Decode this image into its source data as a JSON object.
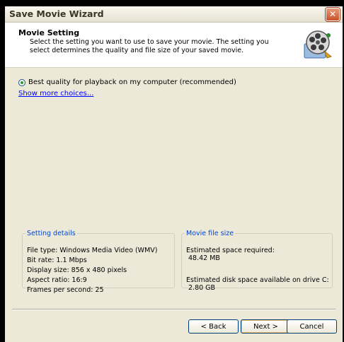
{
  "window": {
    "title": "Save Movie Wizard",
    "close_glyph": "✕"
  },
  "header": {
    "title": "Movie Setting",
    "description": "Select the setting you want to use to save your movie. The setting you select determines the quality and file size of your saved movie.",
    "icon": "film-reel-icon"
  },
  "options": {
    "selected_label": "Best quality for playback on my computer (recommended)",
    "more_link": "Show more choices..."
  },
  "setting_details": {
    "legend": "Setting details",
    "lines": [
      "File type: Windows Media Video (WMV)",
      "Bit rate: 1.1 Mbps",
      "Display size: 856 x 480 pixels",
      "Aspect ratio: 16:9",
      "Frames per second: 25"
    ]
  },
  "file_size": {
    "legend": "Movie file size",
    "required_label": "Estimated space required:",
    "required_value": "48.42 MB",
    "available_label": "Estimated disk space available on drive C:",
    "available_value": "2.80 GB"
  },
  "buttons": {
    "back": "< Back",
    "next": "Next >",
    "cancel": "Cancel"
  },
  "colors": {
    "accent": "#0046d5",
    "link": "#0000ff",
    "close": "#c9502a"
  }
}
